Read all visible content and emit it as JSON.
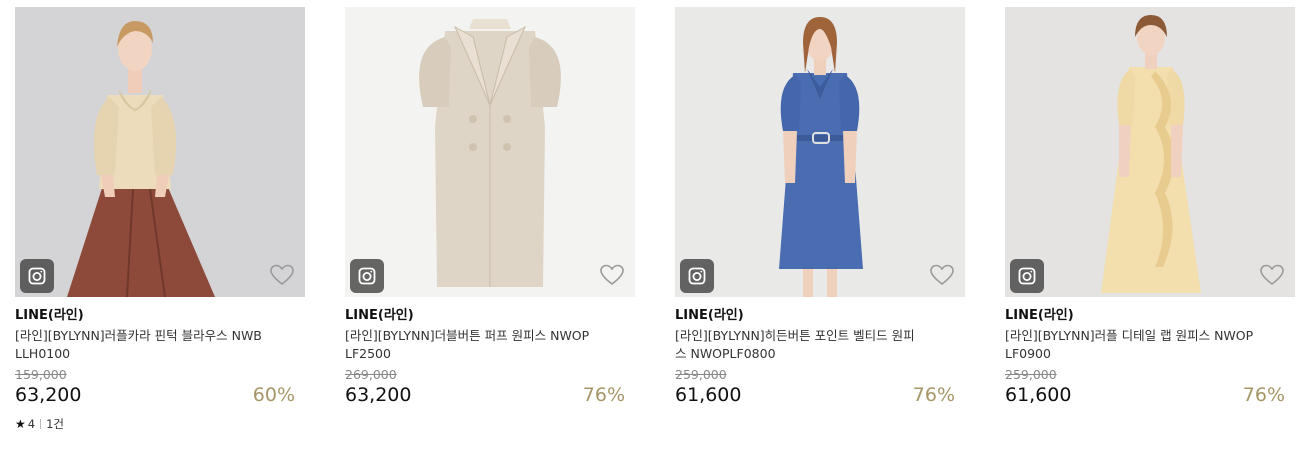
{
  "products": [
    {
      "brand": "LINE(라인)",
      "name": "[라인][BYLYNN]러플카라 핀턱 블라우스 NWBLLH0100",
      "original_price": "159,000",
      "price": "63,200",
      "discount": "60%",
      "rating": "4",
      "review_count": "1건",
      "image": "model-blouse-skirt"
    },
    {
      "brand": "LINE(라인)",
      "name": "[라인][BYLYNN]더블버튼 퍼프 원피스 NWOPLF2500",
      "original_price": "269,000",
      "price": "63,200",
      "discount": "76%",
      "image": "beige-double-button-dress"
    },
    {
      "brand": "LINE(라인)",
      "name": "[라인][BYLYNN]히든버튼 포인트 벨티드 원피스 NWOPLF0800",
      "original_price": "259,000",
      "price": "61,600",
      "discount": "76%",
      "image": "model-blue-belted-dress"
    },
    {
      "brand": "LINE(라인)",
      "name": "[라인][BYLYNN]러플 디테일 랩 원피스 NWOPLF0900",
      "original_price": "259,000",
      "price": "61,600",
      "discount": "76%",
      "image": "model-yellow-ruffle-dress"
    }
  ],
  "colors": {
    "discount": "#a69667",
    "quick_view_bg": "#3c3c3c",
    "wishlist_stroke": "#9a9a9a"
  },
  "icons": {
    "quick_view": "camera-lens-icon",
    "wishlist": "heart-outline-icon",
    "rating": "star-icon"
  }
}
